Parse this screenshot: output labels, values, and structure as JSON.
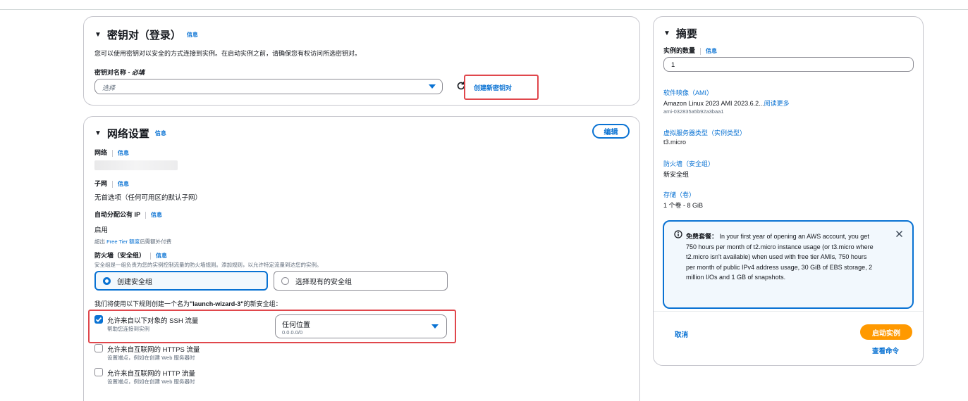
{
  "keypair": {
    "title": "密钥对（登录）",
    "info": "信息",
    "desc": "您可以使用密钥对以安全的方式连接到实例。在启动实例之前，请确保您有权访问所选密钥对。",
    "name_label": "密钥对名称 -",
    "required": "必填",
    "select_placeholder": "选择",
    "create_link": "创建新密钥对"
  },
  "network": {
    "title": "网络设置",
    "info": "信息",
    "edit_btn": "编辑",
    "network_label": "网络",
    "subnet_label": "子网",
    "subnet_value": "无首选项（任何可用区的默认子网）",
    "public_ip_label": "自动分配公有 IP",
    "public_ip_value": "启用",
    "free_tier_prefix": "超出",
    "free_tier_link": "Free Tier 额度",
    "free_tier_suffix": "后需额外付费",
    "firewall_label": "防火墙（安全组）",
    "firewall_desc": "安全组是一组负责为您的实例控制流量的防火墙规则。添加规则，以允许特定流量到达您的实例。",
    "radio_create": "创建安全组",
    "radio_existing": "选择现有的安全组",
    "rule_intro_prefix": "我们将使用以下规则创建一个名为",
    "rule_intro_name": "\"launch-wizard-3\"",
    "rule_intro_suffix": "的新安全组：",
    "ssh_label": "允许来自以下对象的 SSH 流量",
    "ssh_hint": "帮助您连接到实例",
    "ssh_source": "任何位置",
    "ssh_cidr": "0.0.0.0/0",
    "https_label": "允许来自互联网的 HTTPS 流量",
    "https_hint": "设置端点，例如在创建 Web 服务器时",
    "http_label": "允许来自互联网的 HTTP 流量",
    "http_hint": "设置端点，例如在创建 Web 服务器时"
  },
  "summary": {
    "title": "摘要",
    "count_label": "实例的数量",
    "info": "信息",
    "count_value": "1",
    "ami_label": "软件映像（AMI）",
    "ami_value": "Amazon Linux 2023 AMI 2023.6.2...",
    "ami_more": "阅读更多",
    "ami_id": "ami-032835a5b92a3baa1",
    "type_label": "虚拟服务器类型（实例类型）",
    "type_value": "t3.micro",
    "fw_label": "防火墙（安全组）",
    "fw_value": "新安全组",
    "storage_label": "存储（卷）",
    "storage_value": "1 个卷 - 8 GiB",
    "free_title": "免费套餐：",
    "free_text": "In your first year of opening an AWS account, you get 750 hours per month of t2.micro instance usage (or t3.micro where t2.micro isn't available) when used with free tier AMIs, 750 hours per month of public IPv4 address usage, 30 GiB of EBS storage, 2 million I/Os and 1 GB of snapshots.",
    "cancel": "取消",
    "launch": "启动实例",
    "view_cmd": "查看命令"
  },
  "colors": {
    "link": "#0972d3",
    "primary": "#ff9900",
    "highlight": "#e0474c"
  }
}
